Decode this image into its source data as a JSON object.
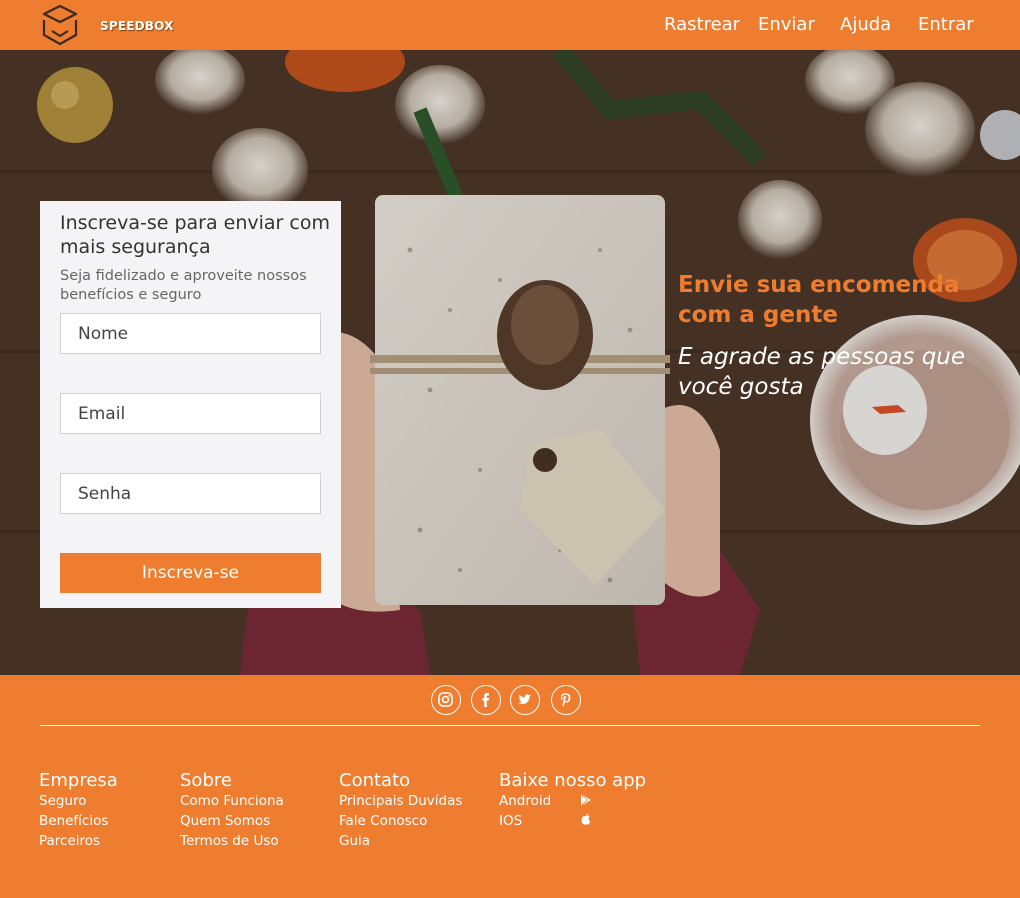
{
  "header": {
    "brand": "SPEEDBOX",
    "nav": [
      "Rastrear",
      "Enviar",
      "Ajuda",
      "Entrar"
    ]
  },
  "signup": {
    "title": "Inscreva-se para enviar com mais segurança",
    "subtitle": "Seja fidelizado e aproveite nossos benefícios e seguro",
    "name_placeholder": "Nome",
    "email_placeholder": "Email",
    "password_placeholder": "Senha",
    "submit_label": "Inscreva-se"
  },
  "hero": {
    "title": "Envie sua encomenda com a gente",
    "subtitle": "E agrade as pessoas que você gosta"
  },
  "footer": {
    "social_icons": [
      "instagram-icon",
      "facebook-icon",
      "twitter-icon",
      "pinterest-icon"
    ],
    "columns": [
      {
        "heading": "Empresa",
        "items": [
          "Seguro",
          "Benefícios",
          "Parceiros"
        ]
      },
      {
        "heading": "Sobre",
        "items": [
          "Como Funciona",
          "Quem Somos",
          "Termos de Uso"
        ]
      },
      {
        "heading": "Contato",
        "items": [
          "Principais Duvídas",
          "Fale Conosco",
          "Guia"
        ]
      },
      {
        "heading": "Baixe nosso app",
        "items": [
          "Android",
          "IOS"
        ]
      }
    ]
  },
  "colors": {
    "brand_orange": "#ef7d2f",
    "card_background": "#f4f4f6",
    "text_white": "#ffffff"
  }
}
